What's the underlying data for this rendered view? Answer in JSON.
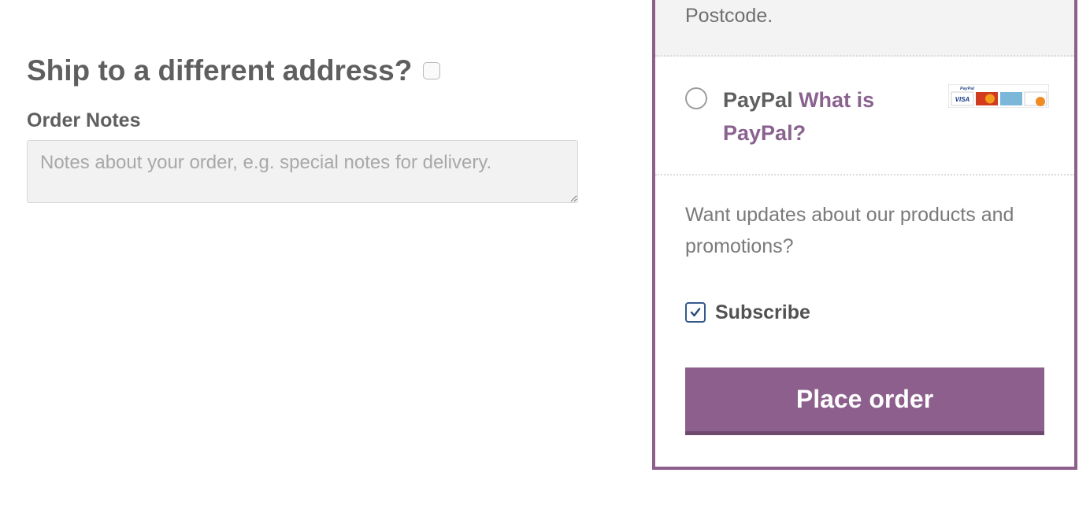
{
  "left": {
    "ship_heading": "Ship to a different address?",
    "order_notes_label": "Order Notes",
    "order_notes_placeholder": "Notes about your order, e.g. special notes for delivery."
  },
  "right": {
    "postcode_tail": "Postcode.",
    "paypal_label": "PayPal ",
    "paypal_what_is": "What is PayPal?",
    "updates_text": "Want updates about our products and promotions?",
    "subscribe_label": "Subscribe",
    "place_order_label": "Place order"
  },
  "colors": {
    "panel_border": "#8c5f8c",
    "button_bg": "#8c5f8c",
    "button_border": "#6e4a6e",
    "link": "#8a628f"
  }
}
